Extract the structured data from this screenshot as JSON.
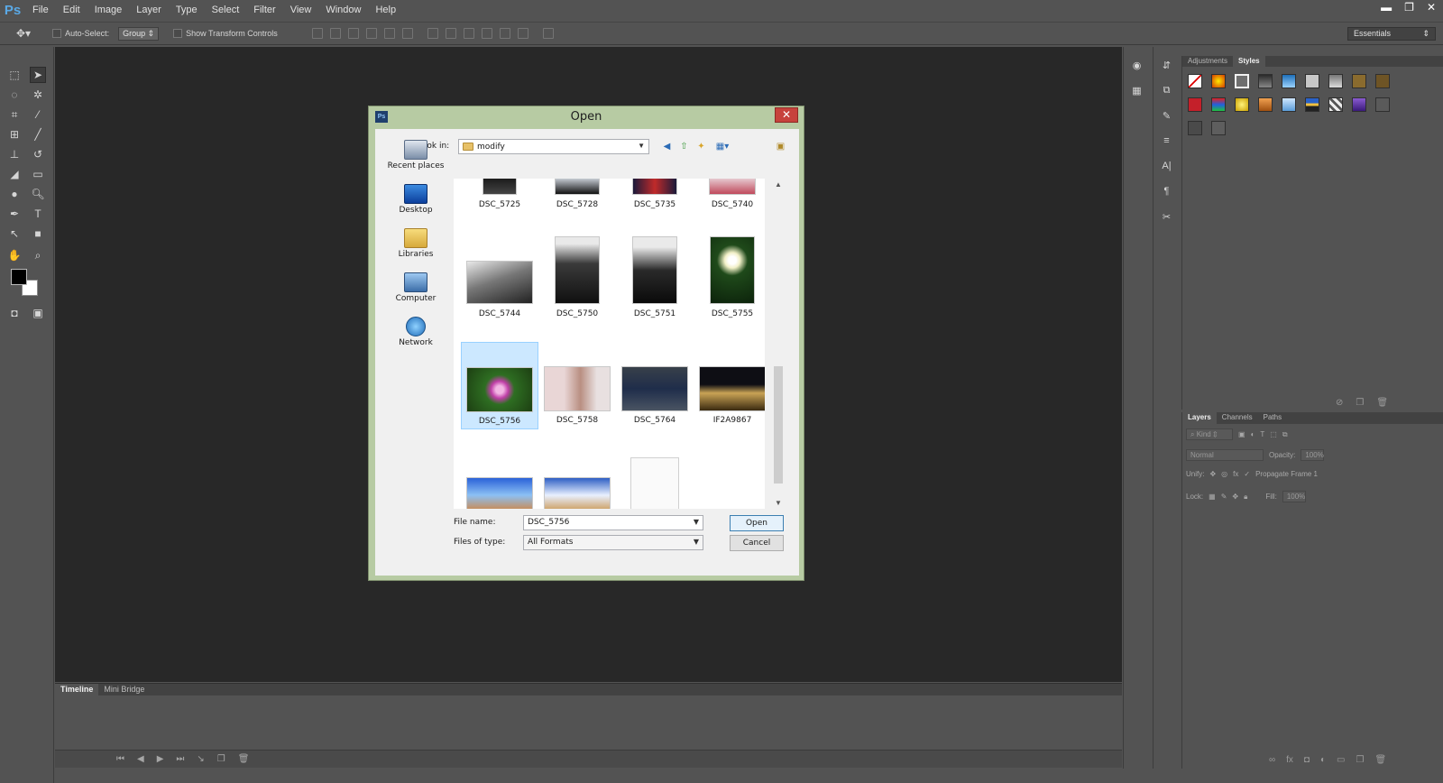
{
  "app": {
    "logo": "Ps"
  },
  "menubar": {
    "items": [
      "File",
      "Edit",
      "Image",
      "Layer",
      "Type",
      "Select",
      "Filter",
      "View",
      "Window",
      "Help"
    ]
  },
  "window_controls": {
    "minimize": "▬",
    "restore": "❐",
    "close": "✕"
  },
  "options_bar": {
    "auto_select_label": "Auto-Select:",
    "auto_select_value": "Group",
    "show_transform_label": "Show Transform Controls",
    "workspace": "Essentials"
  },
  "timeline": {
    "tabs": [
      "Timeline",
      "Mini Bridge"
    ]
  },
  "styles_panel": {
    "tabs": [
      "Adjustments",
      "Styles"
    ]
  },
  "layers_panel": {
    "tabs": [
      "Layers",
      "Channels",
      "Paths"
    ],
    "filter_kind": "Kind",
    "blend_mode": "Normal",
    "opacity_label": "Opacity:",
    "opacity_value": "100%",
    "unify_label": "Unify:",
    "propagate_label": "Propagate Frame 1",
    "lock_label": "Lock:",
    "fill_label": "Fill:",
    "fill_value": "100%"
  },
  "dialog": {
    "title": "Open",
    "icon": "Ps",
    "look_in_label": "Look in:",
    "look_in_value": "modify",
    "places": [
      "Recent places",
      "Desktop",
      "Libraries",
      "Computer",
      "Network"
    ],
    "files_row1": [
      "DSC_5725",
      "DSC_5728",
      "DSC_5735",
      "DSC_5740"
    ],
    "files_row2": [
      "DSC_5744",
      "DSC_5750",
      "DSC_5751",
      "DSC_5755"
    ],
    "files_row3": [
      "DSC_5756",
      "DSC_5758",
      "DSC_5764",
      "IF2A9867"
    ],
    "file_name_label": "File name:",
    "file_name_value": "DSC_5756",
    "files_of_type_label": "Files of type:",
    "files_of_type_value": "All Formats",
    "open_button": "Open",
    "cancel_button": "Cancel"
  },
  "colors": {
    "canvas": "#282828",
    "panel": "#535353",
    "dialog_frame": "#b7cba3",
    "selection": "#cce8ff"
  }
}
